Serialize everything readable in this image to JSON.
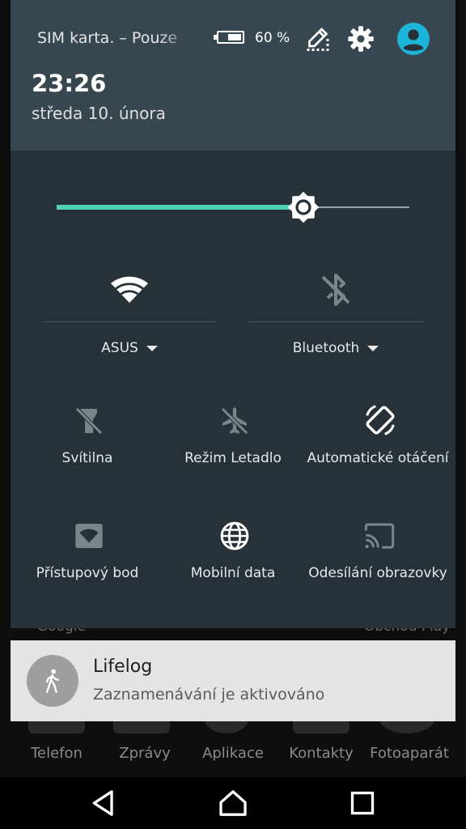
{
  "background": {
    "labels": {
      "left": "Google",
      "right": "Obchod Play"
    },
    "dock": [
      "Telefon",
      "Zprávy",
      "Aplikace",
      "Kontakty",
      "Fotoaparát"
    ]
  },
  "header": {
    "carrier": "SIM karta. – Pouze",
    "battery_percent_label": "60 %",
    "battery_level": 0.6,
    "time": "23:26",
    "date": "středa 10. února",
    "icons": [
      "edit-icon",
      "settings-icon",
      "user-icon"
    ]
  },
  "brightness": {
    "level": 0.7
  },
  "tiles_big": [
    {
      "label": "ASUS",
      "icon": "wifi-icon"
    },
    {
      "label": "Bluetooth",
      "icon": "bluetooth-off-icon"
    }
  ],
  "tiles": [
    {
      "label": "Svítilna",
      "icon": "flashlight-off-icon"
    },
    {
      "label": "Režim Letadlo",
      "icon": "airplane-off-icon"
    },
    {
      "label": "Automatické otáčení",
      "icon": "auto-rotate-icon"
    },
    {
      "label": "Přístupový bod",
      "icon": "hotspot-icon"
    },
    {
      "label": "Mobilní data",
      "icon": "mobile-data-icon"
    },
    {
      "label": "Odesílání obrazovky",
      "icon": "cast-icon"
    }
  ],
  "notification": {
    "title": "Lifelog",
    "text": "Zaznamenávání je aktivováno",
    "icon": "walking-person-icon"
  },
  "navbar": {
    "buttons": [
      "back-icon",
      "home-icon",
      "recents-icon"
    ]
  },
  "colors": {
    "accent": "#4fd1b3",
    "shade": "#263238",
    "header": "#37474f",
    "user": "#1cb5d9"
  }
}
